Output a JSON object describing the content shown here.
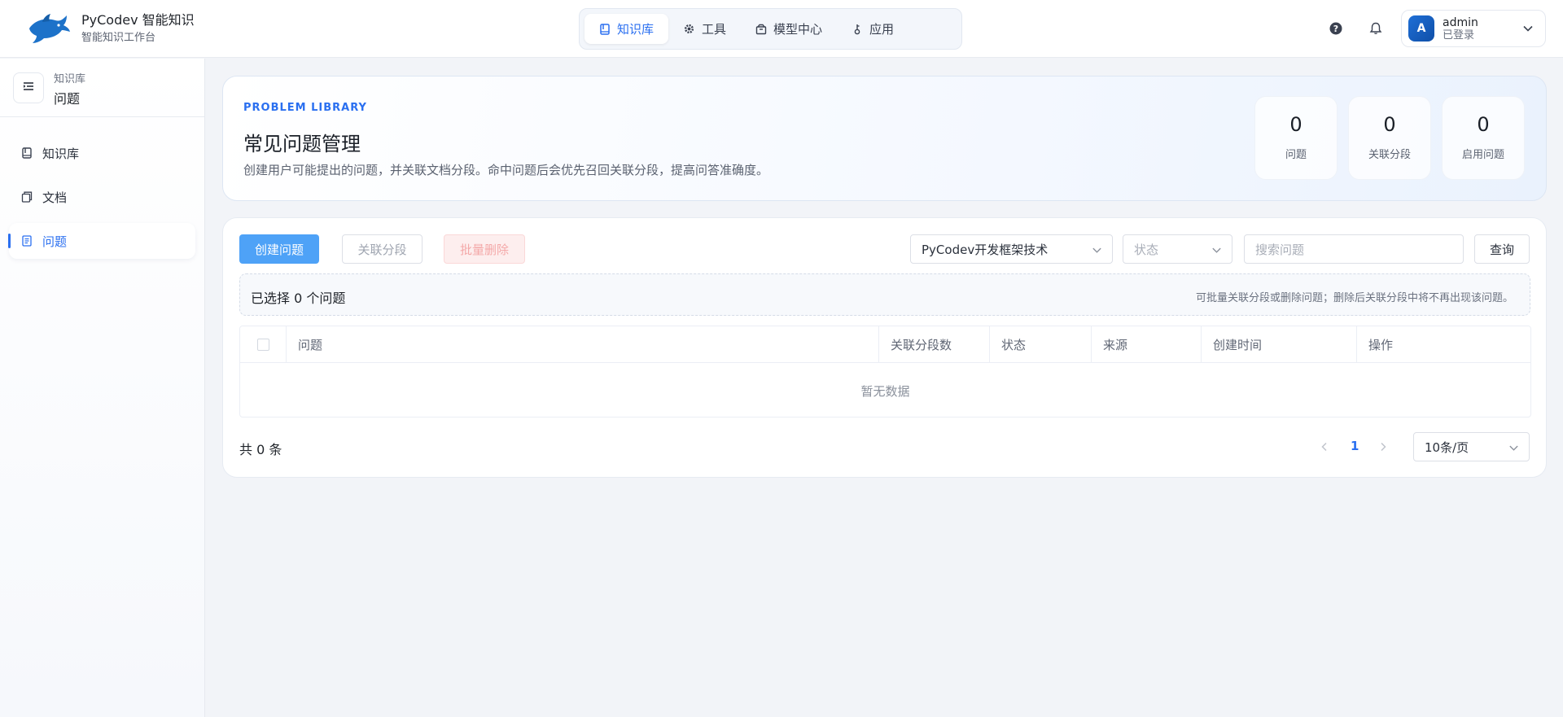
{
  "header": {
    "brand_title": "PyCodev 智能知识",
    "brand_subtitle": "智能知识工作台",
    "nav": [
      {
        "label": "知识库",
        "icon": "book-icon",
        "active": true
      },
      {
        "label": "工具",
        "icon": "gear-icon",
        "active": false
      },
      {
        "label": "模型中心",
        "icon": "box-icon",
        "active": false
      },
      {
        "label": "应用",
        "icon": "key-icon",
        "active": false
      }
    ],
    "user": {
      "avatar_letter": "A",
      "name": "admin",
      "status": "已登录"
    }
  },
  "sidebar": {
    "breadcrumb": "知识库",
    "title": "问题",
    "items": [
      {
        "label": "知识库",
        "icon": "book-icon",
        "active": false
      },
      {
        "label": "文档",
        "icon": "documents-icon",
        "active": false
      },
      {
        "label": "问题",
        "icon": "list-doc-icon",
        "active": true
      }
    ]
  },
  "hero": {
    "kicker": "PROBLEM LIBRARY",
    "title": "常见问题管理",
    "description": "创建用户可能提出的问题，并关联文档分段。命中问题后会优先召回关联分段，提高问答准确度。",
    "stats": [
      {
        "value": "0",
        "label": "问题"
      },
      {
        "value": "0",
        "label": "关联分段"
      },
      {
        "value": "0",
        "label": "启用问题"
      }
    ]
  },
  "toolbar": {
    "create_label": "创建问题",
    "link_label": "关联分段",
    "batch_delete_label": "批量删除",
    "knowledge_select_value": "PyCodev开发框架技术",
    "status_placeholder": "状态",
    "search_placeholder": "搜索问题",
    "query_label": "查询"
  },
  "selection": {
    "summary": "已选择 0 个问题",
    "hint": "可批量关联分段或删除问题；删除后关联分段中将不再出现该问题。"
  },
  "table": {
    "columns": [
      "问题",
      "关联分段数",
      "状态",
      "来源",
      "创建时间",
      "操作"
    ],
    "rows": [],
    "empty_text": "暂无数据"
  },
  "pagination": {
    "total_text": "共 0 条",
    "current_page": "1",
    "page_size": "10条/页"
  },
  "colors": {
    "accent": "#2a6ff0",
    "primary_button": "#4ea2f7",
    "danger_soft": "#fdeeee",
    "page_bg": "#f2f4f8"
  }
}
